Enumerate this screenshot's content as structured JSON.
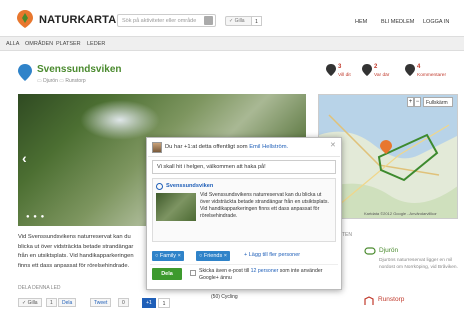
{
  "header": {
    "logo_text": "NATURKARTAN",
    "search_placeholder": "Sök på aktiviteter eller område",
    "like_label": "✓ Gilla",
    "like_count": "1",
    "nav": [
      "HEM",
      "BLI MEDLEM",
      "LOGGA IN"
    ]
  },
  "subnav": [
    "ALLA",
    "OMRÅDEN",
    "PLATSER",
    "LEDER"
  ],
  "place": {
    "title": "Svenssundsviken",
    "crumb_1": "Djurön",
    "crumb_2": "Runstorp",
    "stats": [
      {
        "count": "3",
        "label": "Vill dit"
      },
      {
        "count": "2",
        "label": "Var där"
      },
      {
        "count": "4",
        "label": "Kommentarer"
      }
    ],
    "description": "Vid Svenssundsvikens naturreservat kan du blicka ut över vidsträckta betade strandängar från en utsiktsplats. Vid handikapparkeringen finns ett dass anpassat för rörelsehindrade.",
    "share_label": "DELA DENNA LED",
    "share_buttons": [
      "✓ Gilla",
      "1",
      "Dela",
      "Tweet",
      "0"
    ]
  },
  "map": {
    "fullscreen_label": "Fullskärm",
    "credit": "Kartdata ©2012 Google - Användarvillkor"
  },
  "sidebar": {
    "items": [
      {
        "title": "Djurön",
        "desc": "Djuröns naturreservat ligger en mil nordost om Norrköping, vid Bråviken."
      },
      {
        "title": "Runstorp",
        "desc": ""
      }
    ],
    "section_label": "TEN"
  },
  "popup": {
    "head_text": "Du har +1:at detta offentligt som",
    "head_link": "Emil Hellström.",
    "message": "Vi skall hit i helgen, välkommen att haka på!",
    "card_title": "Svenssundsviken",
    "card_text": "Vid Svenssundsvikens naturreservat kan du blicka ut över vidsträckta betade strandängar från en utsiktsplats. Vid handikapparkeringen finns ett dass anpassat för rörelsehindrade.",
    "circles": [
      "Family",
      "Friends"
    ],
    "add_people": "+ Lägg till fler personer",
    "share_button": "Dela",
    "email_text": "Skicka även e-post till",
    "email_link": "12 personer",
    "email_tail": "som inte använder Google+ ännu",
    "plus_label": "+1",
    "plus_count": "1",
    "cycling": "Cycling",
    "cycling_count": "(50)"
  },
  "colors": {
    "brand_green": "#4a8a2e",
    "link_blue": "#1f5fb8",
    "accent_red": "#c0392b",
    "share_green": "#3d9a2e"
  }
}
